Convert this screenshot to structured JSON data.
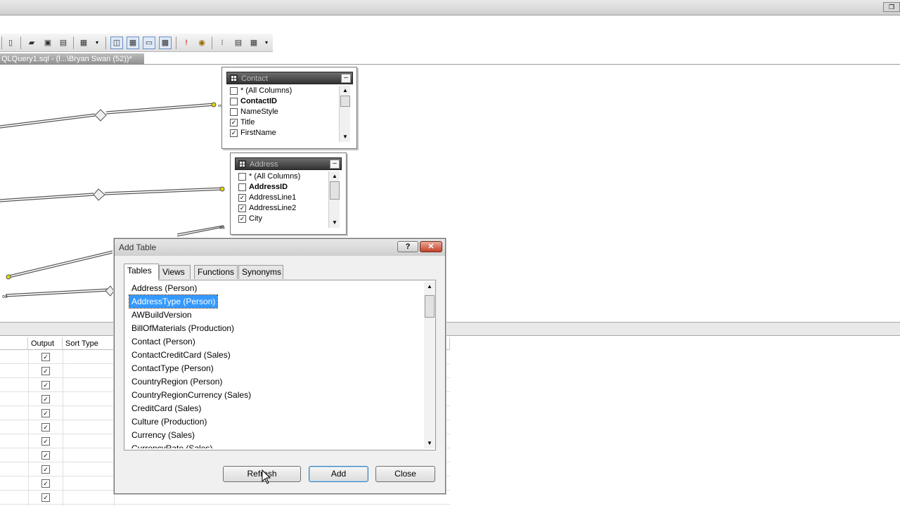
{
  "window": {
    "title": "",
    "restore_glyph": "❐"
  },
  "toolbar": {
    "icons": [
      "new-query-icon",
      "open-icon",
      "save-icon",
      "print-icon",
      "change-type-icon",
      "show-diagram-pane-icon",
      "show-criteria-pane-icon",
      "show-sql-pane-icon",
      "show-results-pane-icon",
      "execute-sql-icon",
      "verify-sql-icon",
      "group-by-icon",
      "add-table-icon",
      "add-derived-table-icon"
    ]
  },
  "document_tab": {
    "label": "QLQuery1.sql - (l...\\Bryan Swan (52))*"
  },
  "diagram": {
    "table1": {
      "name": "Contact",
      "columns": [
        {
          "label": "* (All Columns)",
          "checked": false,
          "key": false
        },
        {
          "label": "ContactID",
          "checked": false,
          "key": true
        },
        {
          "label": "NameStyle",
          "checked": false,
          "key": false
        },
        {
          "label": "Title",
          "checked": true,
          "key": false
        },
        {
          "label": "FirstName",
          "checked": true,
          "key": false
        }
      ]
    },
    "table2": {
      "name": "Address",
      "columns": [
        {
          "label": "* (All Columns)",
          "checked": false,
          "key": false
        },
        {
          "label": "AddressID",
          "checked": false,
          "key": true
        },
        {
          "label": "AddressLine1",
          "checked": true,
          "key": false
        },
        {
          "label": "AddressLine2",
          "checked": true,
          "key": false
        },
        {
          "label": "City",
          "checked": true,
          "key": false
        }
      ]
    }
  },
  "grid": {
    "headers": {
      "output": "Output",
      "sort_type": "Sort Type"
    },
    "rows_checked": [
      true,
      true,
      true,
      true,
      true,
      true,
      true,
      true,
      true,
      true,
      true
    ]
  },
  "dialog": {
    "title": "Add Table",
    "help_label": "?",
    "close_label": "✕",
    "tabs": [
      "Tables",
      "Views",
      "Functions",
      "Synonyms"
    ],
    "active_tab": 0,
    "items": [
      "Address (Person)",
      "AddressType (Person)",
      "AWBuildVersion",
      "BillOfMaterials (Production)",
      "Contact (Person)",
      "ContactCreditCard (Sales)",
      "ContactType (Person)",
      "CountryRegion (Person)",
      "CountryRegionCurrency (Sales)",
      "CreditCard (Sales)",
      "Culture (Production)",
      "Currency (Sales)",
      "CurrencyRate (Sales)"
    ],
    "selected_index": 1,
    "buttons": {
      "refresh": "Refresh",
      "add": "Add",
      "close": "Close"
    }
  }
}
